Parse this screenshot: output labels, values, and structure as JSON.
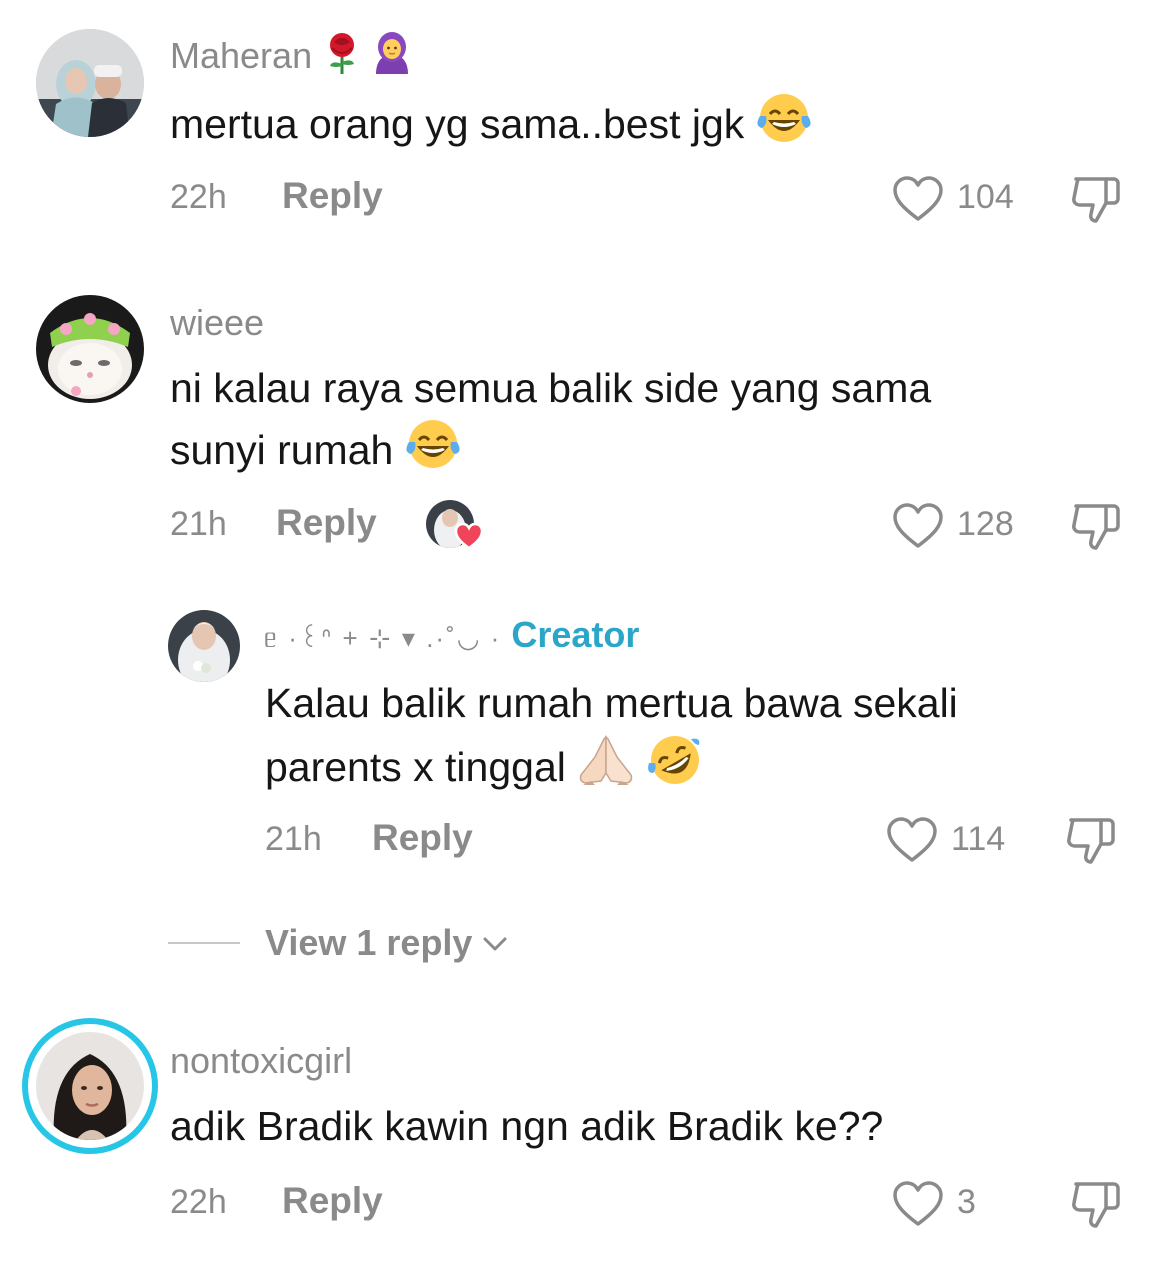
{
  "comments": [
    {
      "username": "Maheran",
      "username_emoji": [
        "rose-emoji",
        "woman-with-headscarf-emoji"
      ],
      "text": "mertua orang yg sama..best jgk",
      "text_emoji": "face-with-tears-of-joy-emoji",
      "time": "22h",
      "reply_label": "Reply",
      "likes": "104"
    },
    {
      "username": "wieee",
      "text_line1": "ni kalau raya semua balik side yang sama",
      "text_line2": "sunyi rumah",
      "text_emoji": "face-with-tears-of-joy-emoji",
      "time": "21h",
      "reply_label": "Reply",
      "likes": "128",
      "creator_liked": true,
      "reply": {
        "username": "ᥱ ·꒰ᐢ + ⊹ ▾ .·˚◡ ·",
        "badge": "Creator",
        "text_line1": "Kalau balik rumah mertua bawa sekali",
        "text_line2": "parents x tinggal",
        "text_emoji": [
          "folded-hands-emoji",
          "rolling-on-floor-laughing-emoji"
        ],
        "time": "21h",
        "reply_label": "Reply",
        "likes": "114"
      },
      "view_replies": "View 1 reply"
    },
    {
      "username": "nontoxicgirl",
      "text": "adik Bradik kawin ngn adik Bradik ke??",
      "time": "22h",
      "reply_label": "Reply",
      "likes": "3",
      "avatar_ring_color": "#28c6e6"
    }
  ],
  "colors": {
    "text": "#161616",
    "muted": "#8a8a8a",
    "creator": "#2aa6c9",
    "heart_badge": "#f0445a"
  }
}
